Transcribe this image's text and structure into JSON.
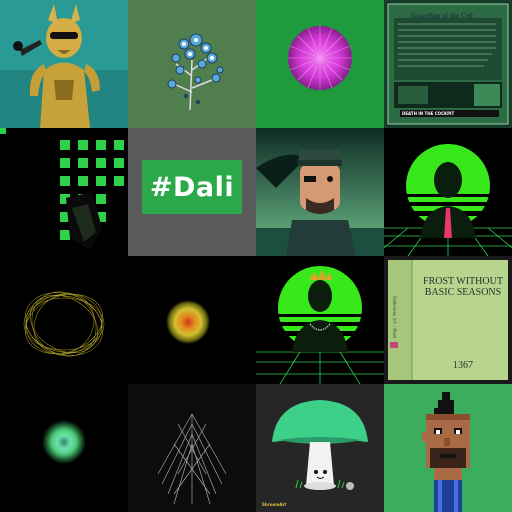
{
  "gallery": {
    "tiles": [
      {
        "id": "t1",
        "name": "dog-warrior-nft"
      },
      {
        "id": "t2",
        "name": "blossom-tree-nft"
      },
      {
        "id": "t3",
        "name": "magenta-sphere-nft"
      },
      {
        "id": "t4",
        "name": "trading-card-nft",
        "card_title": "Guardian of the Cell",
        "card_subtitle": "DEATH IN THE COCKPIT"
      },
      {
        "id": "t5",
        "name": "green-squares-nft"
      },
      {
        "id": "t6",
        "name": "dali-hashtag-nft",
        "text": "#Dali"
      },
      {
        "id": "t7",
        "name": "pilot-portrait-nft"
      },
      {
        "id": "t8",
        "name": "synthwave-portrait-nft"
      },
      {
        "id": "t9",
        "name": "golden-ring-nft"
      },
      {
        "id": "t10",
        "name": "orange-orb-nft"
      },
      {
        "id": "t11",
        "name": "crowned-synthwave-nft"
      },
      {
        "id": "t12",
        "name": "book-cover-nft",
        "title": "FROST WITHOUT BASIC SEASONS",
        "number": "1367",
        "spine": "Softcover, 1/1 · Pixel"
      },
      {
        "id": "t13",
        "name": "green-orb-nft"
      },
      {
        "id": "t14",
        "name": "light-rays-nft"
      },
      {
        "id": "t15",
        "name": "mushroom-nft",
        "logo": "ShroomArt"
      },
      {
        "id": "t16",
        "name": "pixel-punk-nft"
      }
    ]
  },
  "colors": {
    "accent_green": "#2aa84a",
    "neon_green": "#39ff14",
    "magenta": "#d63ad8"
  }
}
